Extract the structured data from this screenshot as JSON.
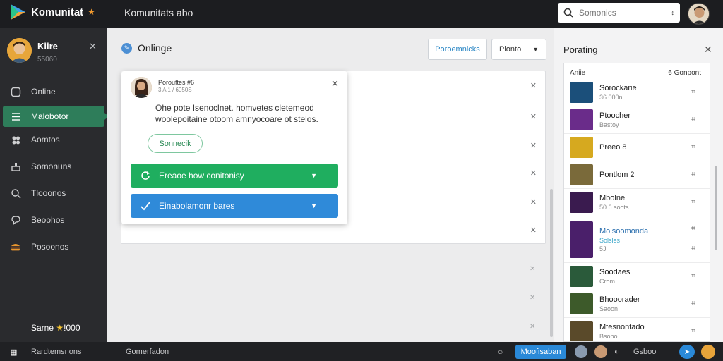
{
  "app": {
    "brand": "Komunitat",
    "title": "Komunitats abo"
  },
  "search": {
    "placeholder": "Somonics"
  },
  "colors": {
    "accent_green": "#2e7d5a",
    "button_green": "#1fae5f",
    "button_blue": "#2f8ad9",
    "sidebar_bg": "#2a2b2e",
    "topbar_bg": "#1c1d20"
  },
  "sidebar": {
    "profile": {
      "name": "Kiire",
      "sub": "55060"
    },
    "items": [
      {
        "label": "Online",
        "icon": "clock-icon",
        "active": false
      },
      {
        "label": "Malobotor",
        "icon": "list-icon",
        "active": true
      },
      {
        "label": "Aomtos",
        "icon": "users-icon",
        "active": false
      },
      {
        "label": "Somonuns",
        "icon": "chart-icon",
        "active": false
      },
      {
        "label": "Tlooonos",
        "icon": "search-icon",
        "active": false
      },
      {
        "label": "Beoohos",
        "icon": "comment-icon",
        "active": false
      },
      {
        "label": "Posoonos",
        "icon": "burger-icon",
        "active": false
      }
    ],
    "footer": {
      "label": "Sarne",
      "star": "★",
      "count": "!000"
    }
  },
  "main": {
    "title": "Onlinge",
    "primary_button": "Poroemnicks",
    "select_value": "Plonto"
  },
  "popup": {
    "name": "Porouftes #6",
    "sub": "3 A 1 / 6050S",
    "body": "Ohe pote Isenoclnet. homvetes cletemeod woolepoitaine otoom amnyocoare ot stelos.",
    "pill": "Sonnecik",
    "bar_green": "Ereaoe how conitonisy",
    "bar_blue": "Einabolamonr bares"
  },
  "rpanel": {
    "title": "Porating",
    "head_left": "Aniie",
    "head_right": "6 Gonpont",
    "items": [
      {
        "name": "Sorockarie",
        "sub": "36 000n",
        "thumb": "#1b4f7a",
        "tall": false,
        "blue": false
      },
      {
        "name": "Ptoocher",
        "sub": "Bastoy",
        "thumb": "#6a2c8a",
        "tall": false,
        "blue": false
      },
      {
        "name": "Preeo 8",
        "sub": "",
        "thumb": "#d6a91f",
        "tall": false,
        "blue": false
      },
      {
        "name": "Pontlom 2",
        "sub": "",
        "thumb": "#7a6a3a",
        "tall": false,
        "blue": false
      },
      {
        "name": "Mbolne",
        "sub": "50 6 soots",
        "thumb": "#3a1b4f",
        "tall": false,
        "blue": false
      },
      {
        "name": "Molsoomonda",
        "sub": "Solsles",
        "sub2": "5J",
        "thumb": "#4a1f6a",
        "tall": true,
        "blue": true
      },
      {
        "name": "Soodaes",
        "sub": "Crom",
        "thumb": "#2a5a3a",
        "tall": false,
        "blue": false
      },
      {
        "name": "Bhooorader",
        "sub": "Saoon",
        "thumb": "#3d5a2a",
        "tall": false,
        "blue": false
      },
      {
        "name": "Mtesnontado",
        "sub": "Bsobo",
        "thumb": "#5a4a2a",
        "tall": false,
        "blue": false
      }
    ]
  },
  "bottombar": {
    "left": "Rardtemsnons",
    "mid": "Gomerfadon",
    "button": "Moofisaban",
    "text": "Gsboo"
  }
}
